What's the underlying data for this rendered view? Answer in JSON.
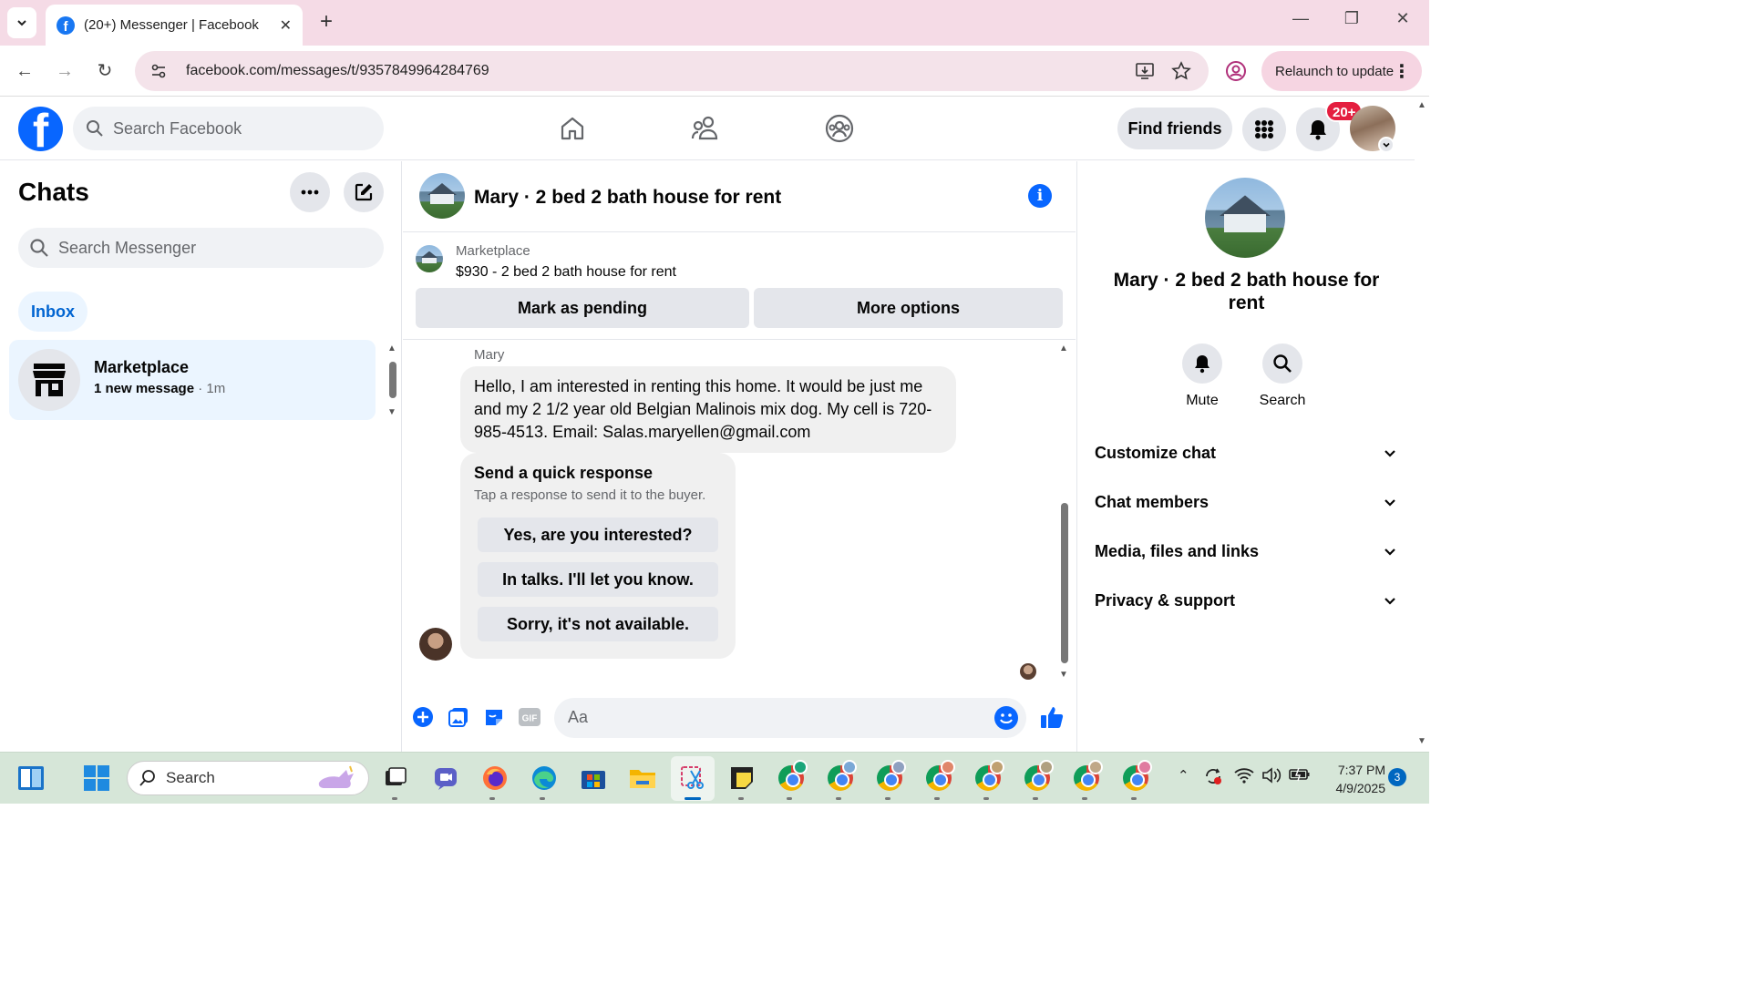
{
  "browser": {
    "tab_title": "(20+) Messenger | Facebook",
    "url": "facebook.com/messages/t/9357849964284769",
    "relaunch_label": "Relaunch to update"
  },
  "fb_nav": {
    "search_placeholder": "Search Facebook",
    "find_friends_label": "Find friends",
    "notifications_badge": "20+"
  },
  "chats_panel": {
    "title": "Chats",
    "search_placeholder": "Search Messenger",
    "filter_label": "Inbox",
    "items": [
      {
        "name": "Marketplace",
        "preview": "1 new message",
        "time": " · 1m",
        "icon": "storefront-icon"
      }
    ]
  },
  "conversation": {
    "title": "Mary · 2 bed 2 bath house for rent",
    "listing": {
      "source_label": "Marketplace",
      "title": "$930 - 2 bed 2 bath house for rent",
      "mark_pending_label": "Mark as pending",
      "more_options_label": "More options"
    },
    "sender_name": "Mary",
    "message_text": "Hello, I am interested in renting this home. It would be just me and my 2 1/2 year old Belgian Malinois mix dog. My cell is 720-985-4513. Email: Salas.maryellen@gmail.com",
    "quick_response": {
      "title": "Send a quick response",
      "subtitle": "Tap a response to send it to the buyer.",
      "options": [
        "Yes, are you interested?",
        "In talks. I'll let you know.",
        "Sorry, it's not available."
      ]
    },
    "composer_placeholder": "Aa"
  },
  "info_panel": {
    "title": "Mary · 2 bed 2 bath house for rent",
    "actions": [
      {
        "label": "Mute",
        "icon": "bell-icon"
      },
      {
        "label": "Search",
        "icon": "search-icon"
      }
    ],
    "sections": [
      "Customize chat",
      "Chat members",
      "Media, files and links",
      "Privacy & support"
    ]
  },
  "taskbar": {
    "search_placeholder": "Search",
    "time": "7:37 PM",
    "date": "4/9/2025",
    "notification_count": "3"
  },
  "colors": {
    "fb_blue": "#0866ff",
    "selected_chat_bg": "#ebf5ff",
    "badge_red": "#e41e3f",
    "browser_tabbar": "#f5dbe6"
  }
}
